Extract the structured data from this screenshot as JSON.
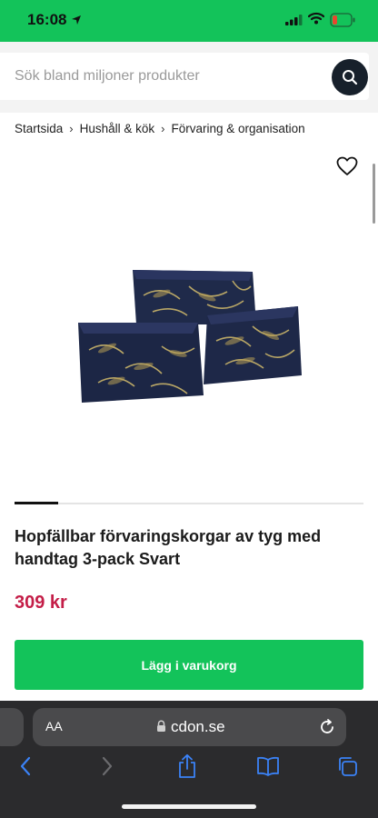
{
  "status": {
    "time": "16:08"
  },
  "search": {
    "placeholder": "Sök bland miljoner produkter"
  },
  "breadcrumb": {
    "items": [
      "Startsida",
      "Hushåll & kök",
      "Förvaring & organisation"
    ],
    "separator": "›"
  },
  "product": {
    "title": "Hopfällbar förvaringskorgar av tyg med handtag 3-pack Svart",
    "price": "309 kr",
    "add_to_cart_label": "Lägg i varukorg"
  },
  "browser": {
    "url": "cdon.se",
    "text_size": "AA"
  },
  "colors": {
    "brand_green": "#13c35a",
    "price": "#c41e48",
    "dark": "#17202b"
  }
}
